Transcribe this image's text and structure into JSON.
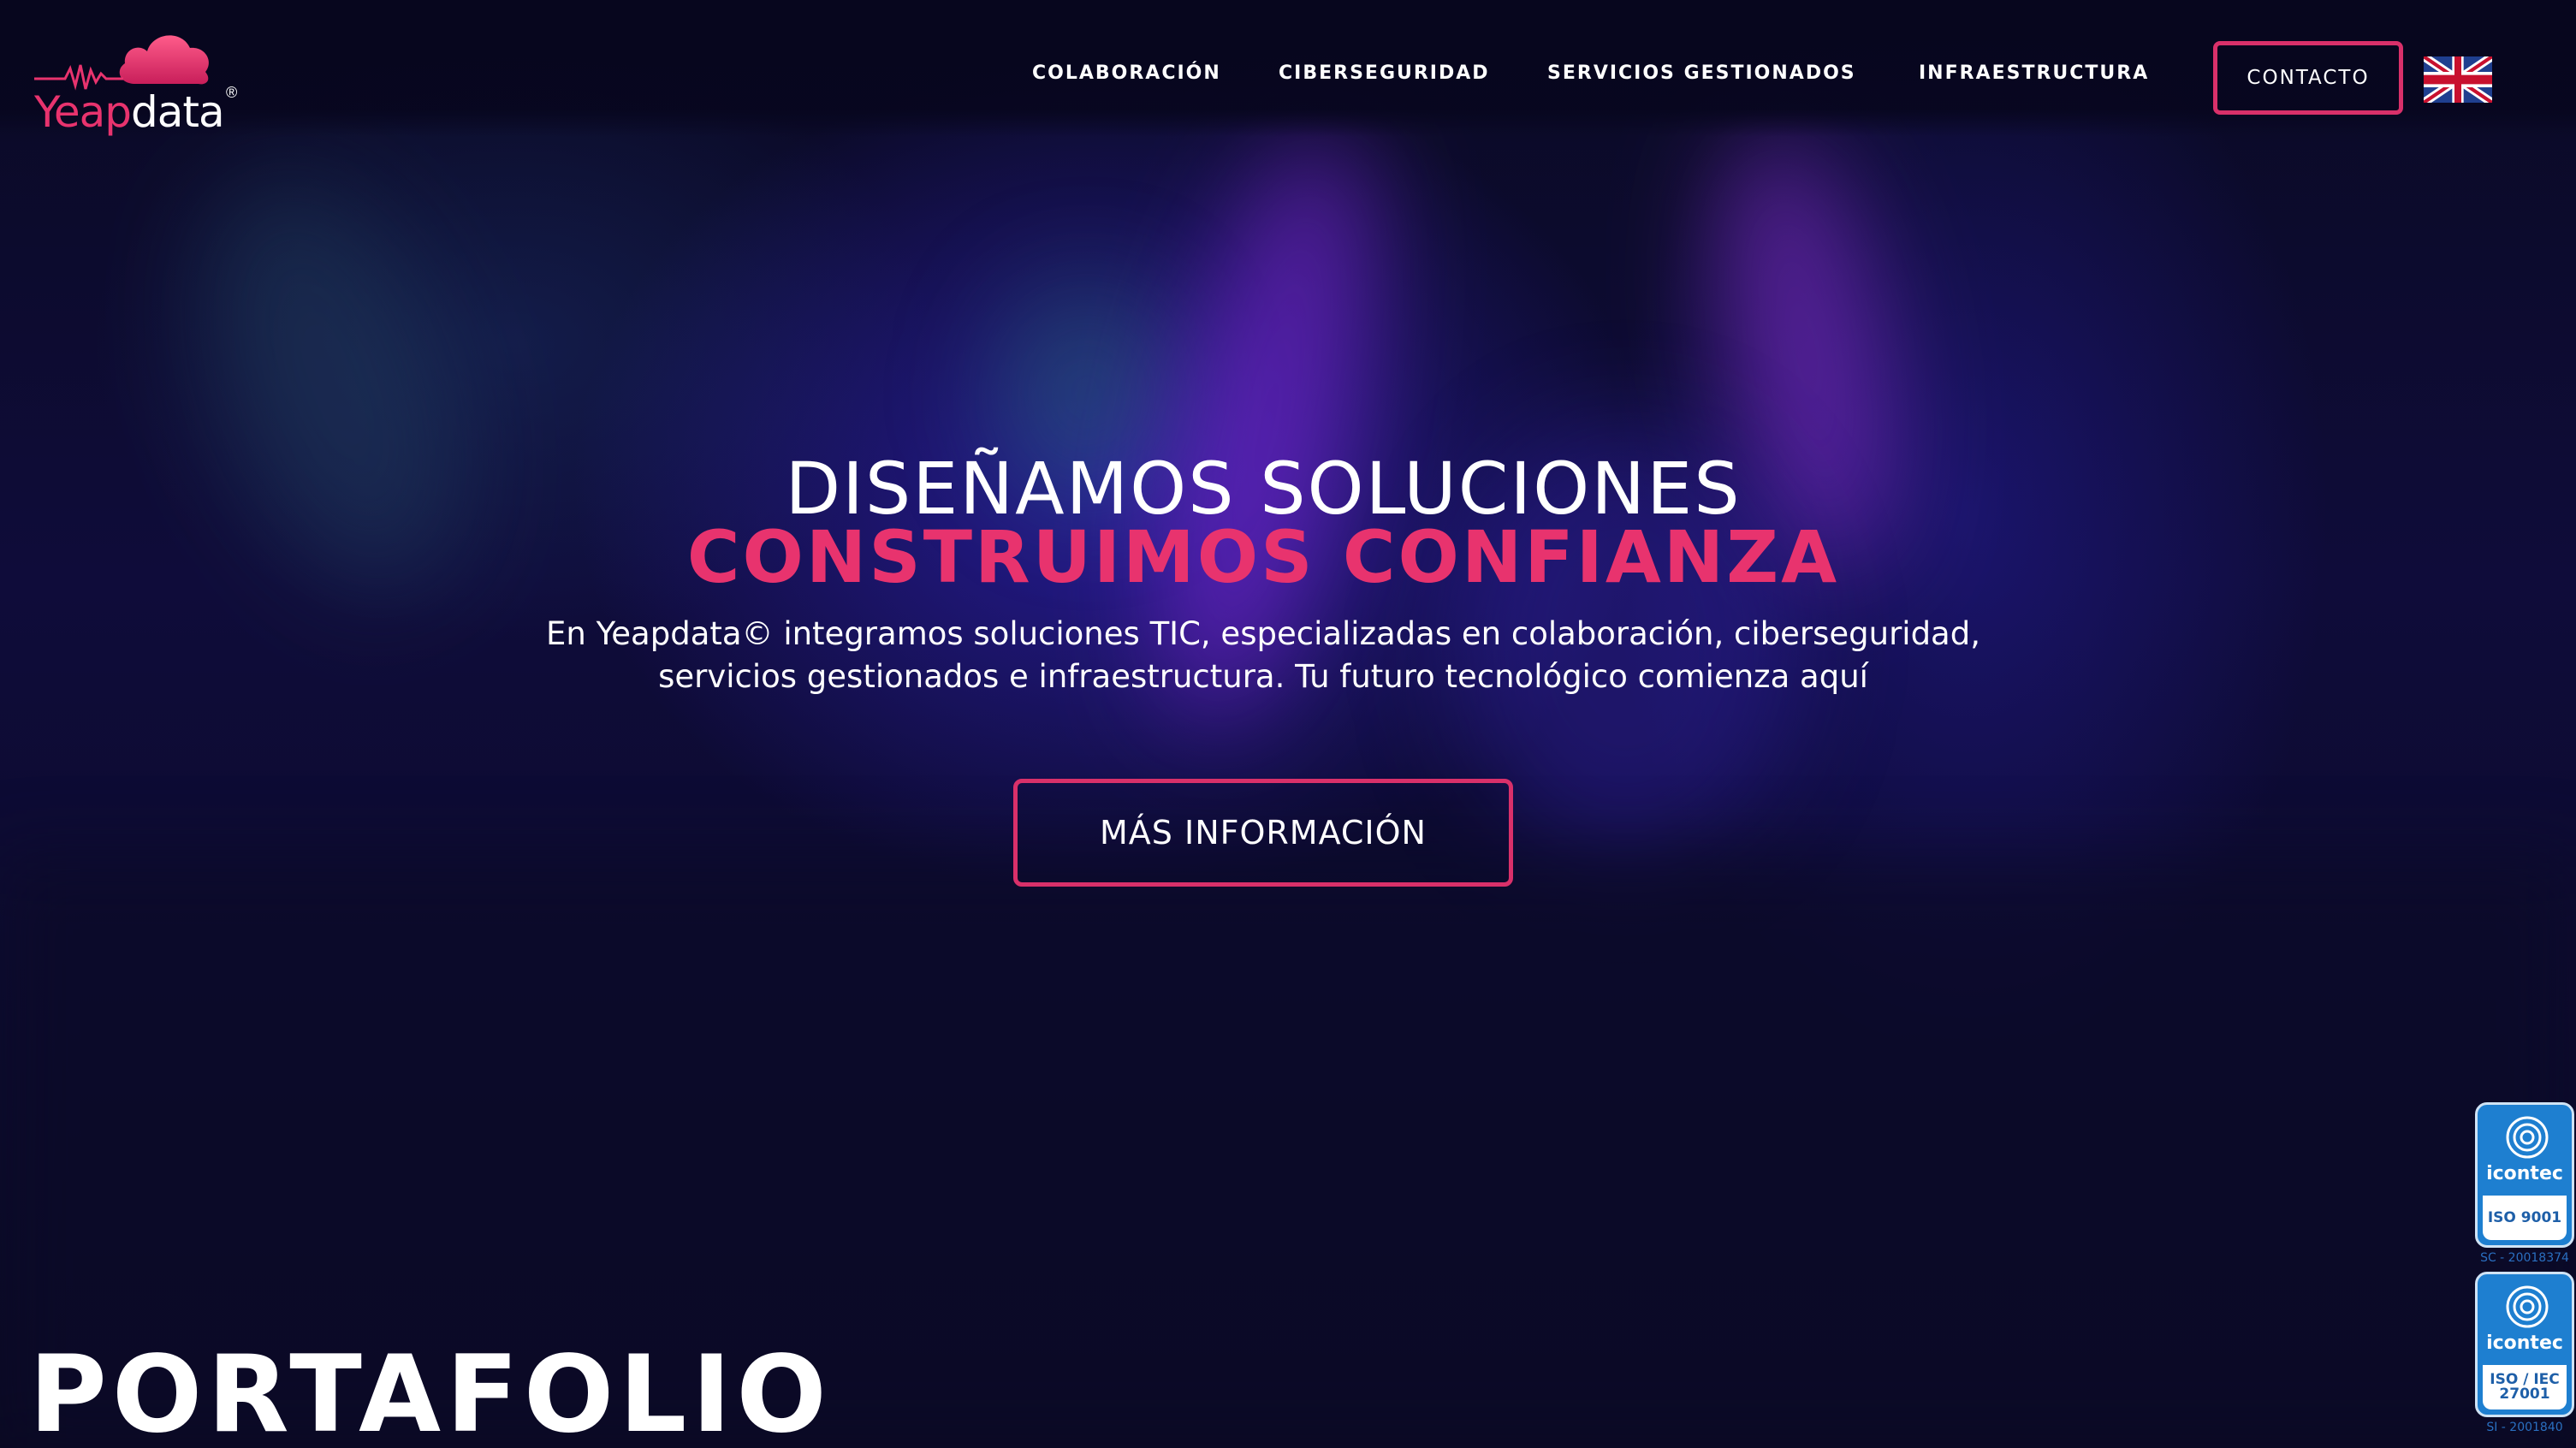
{
  "brand": {
    "logo_part1": "Yeap",
    "logo_part2": "data",
    "logo_reg": "®",
    "accent_color": "#e8336e",
    "background_color": "#0b0a2a"
  },
  "nav": {
    "items": [
      {
        "label": "COLABORACIÓN"
      },
      {
        "label": "CIBERSEGURIDAD"
      },
      {
        "label": "SERVICIOS GESTIONADOS"
      },
      {
        "label": "INFRAESTRUCTURA"
      }
    ],
    "contact_label": "CONTACTO",
    "language_icon": "uk-flag-icon"
  },
  "hero": {
    "title_line1": "DISEÑAMOS SOLUCIONES",
    "title_line2": "CONSTRUIMOS CONFIANZA",
    "description_line1": "En Yeapdata© integramos soluciones TIC, especializadas en colaboración, ciberseguridad,",
    "description_line2": "servicios gestionados e infraestructura. Tu futuro tecnológico comienza aquí",
    "cta_label": "MÁS INFORMACIÓN"
  },
  "section": {
    "title": "PORTAFOLIO"
  },
  "certifications": [
    {
      "org": "icontec",
      "standard_line1": "ISO 9001",
      "standard_line2": "",
      "code": "SC - 20018374"
    },
    {
      "org": "icontec",
      "standard_line1": "ISO / IEC",
      "standard_line2": "27001",
      "code": "SI - 2001840"
    }
  ]
}
